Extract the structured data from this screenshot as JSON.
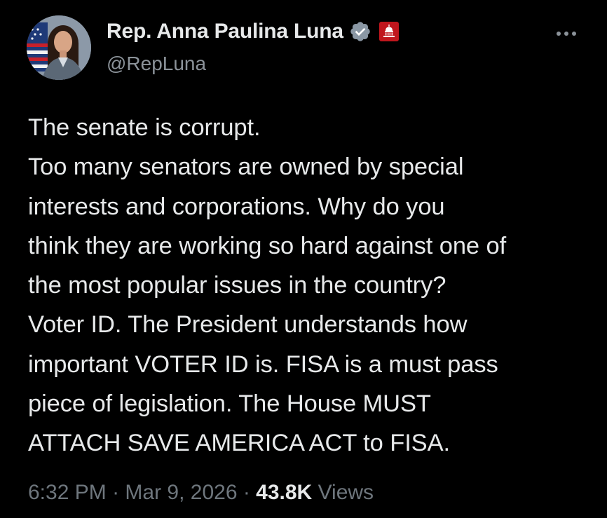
{
  "author": {
    "display_name": "Rep. Anna Paulina Luna",
    "handle": "@RepLuna",
    "avatar_icon": "profile-photo-icon",
    "verified_icon": "verified-badge-icon",
    "affiliation_icon": "us-capitol-badge-icon",
    "verified_color": "#8b98a5",
    "affiliation_color": "#c0161d"
  },
  "more_icon": "more-options-icon",
  "tweet": {
    "lines": [
      "The senate is corrupt.",
      "Too many senators are owned by special",
      "interests and corporations. Why do you",
      "think they are working so hard against one of",
      "the most popular issues in the country?",
      "Voter ID. The President understands how",
      "important VOTER ID is. FISA is a must pass",
      "piece of legislation. The House MUST",
      "ATTACH SAVE AMERICA ACT to FISA."
    ]
  },
  "meta": {
    "time": "6:32 PM",
    "date": "Mar 9, 2026",
    "separator": "·",
    "views_count": "43.8K",
    "views_label": "Views"
  },
  "colors": {
    "background": "#000000",
    "text_primary": "#e7e9ea",
    "text_secondary": "#6e767d"
  }
}
